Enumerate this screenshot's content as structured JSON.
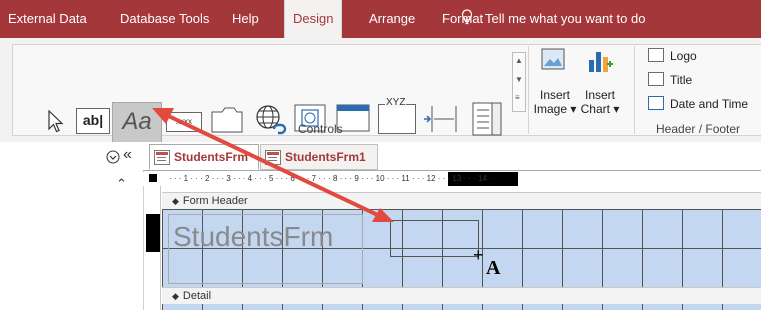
{
  "menubar": {
    "tabs": [
      {
        "label": "External Data",
        "active": false
      },
      {
        "label": "Database Tools",
        "active": false
      },
      {
        "label": "Help",
        "active": false
      },
      {
        "label": "Design",
        "active": true
      },
      {
        "label": "Arrange",
        "active": false
      },
      {
        "label": "Format",
        "active": false
      }
    ],
    "tell_me": "Tell me what you want to do",
    "bg_color": "#a4373a"
  },
  "ribbon": {
    "controls_group_label": "Controls",
    "header_footer_group_label": "Header / Footer",
    "textbox_icon_text": "ab|",
    "label_icon_text": "Aa",
    "button_icon_text": "xxxx",
    "combo_icon_text": "XYZ",
    "insert_image_label": [
      "Insert",
      "Image ▾"
    ],
    "insert_chart_label": [
      "Insert",
      "Chart ▾"
    ],
    "header_footer_items": [
      "Logo",
      "Title",
      "Date and Time"
    ]
  },
  "nav": {
    "collapse_glyph": "«",
    "expand_glyph": "⌃"
  },
  "document": {
    "tabs": [
      {
        "label": "StudentsFrm",
        "active": true
      },
      {
        "label": "StudentsFrm1",
        "active": false
      }
    ],
    "ruler_text": "·  ·  ·  1  ·  ·  ·  2  ·  ·  ·  3  ·  ·  ·  4  ·  ·  ·  5  ·  ·  ·  6  ·  ·  ·  7  ·  ·  ·  8  ·  ·  ·  9  ·  ·  ·  10  ·  ·  ·  11  ·  ·  ·  12  ·  ·  ·  13  ·  ·  ·  14  ·",
    "form_header_label": "Form Header",
    "detail_label": "Detail",
    "title_label_text": "StudentsFrm",
    "cursor_text": "A",
    "arrow_color": "#e24a40",
    "grid_color": "#c3d7f0"
  }
}
